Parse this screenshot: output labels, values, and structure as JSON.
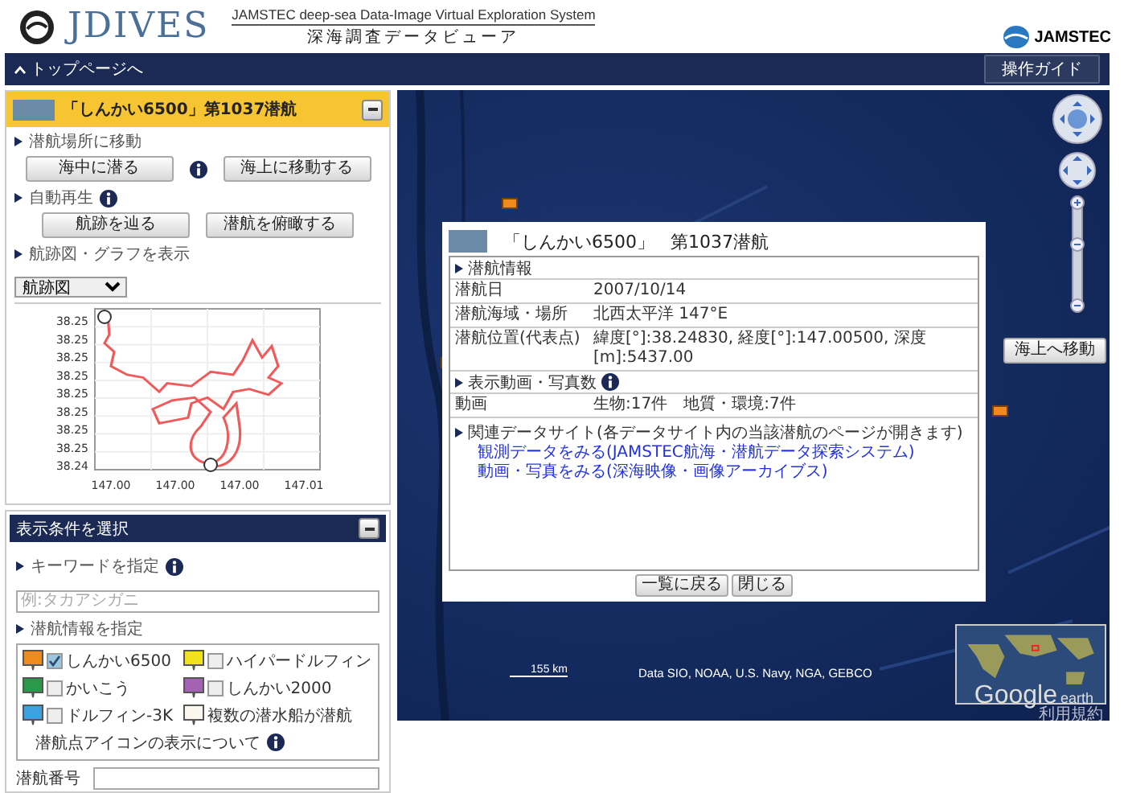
{
  "header": {
    "logo_text": "JDIVES",
    "subtitle_en": "JAMSTEC deep-sea Data-Image Virtual Exploration System",
    "subtitle_ja": "深海調査データビューア",
    "org_name": "JAMSTEC"
  },
  "nav": {
    "back_link": "トップページへ",
    "guide_button": "操作ガイド"
  },
  "dive_panel": {
    "title": "「しんかい6500」第1037潜航",
    "expanded": true,
    "sections": [
      {
        "heading": "潜航場所に移動",
        "buttons": [
          "海中に潜る",
          "海上に移動する"
        ]
      },
      {
        "heading": "自動再生",
        "buttons": [
          "航跡を辿る",
          "潜航を俯瞰する"
        ]
      }
    ],
    "graph_heading": "航跡図・グラフを表示",
    "graph_select": "航跡図",
    "track_plot": {
      "y_tick_labels": [
        "38.25",
        "38.25",
        "38.25",
        "38.25",
        "38.25",
        "38.25",
        "38.25",
        "38.25",
        "38.24"
      ],
      "x_tick_labels": [
        "147.00",
        "147.00",
        "147.00",
        "147.01"
      ]
    }
  },
  "filter_panel": {
    "title": "表示条件を選択",
    "expanded": true,
    "keyword_heading": "キーワードを指定",
    "keyword_placeholder": "例:タカアシガニ",
    "dive_heading": "潜航情報を指定",
    "vessels": [
      {
        "kind": "checkbox",
        "name": "しんかい6500",
        "color": "#f08a1c",
        "checked": true
      },
      {
        "kind": "checkbox",
        "name": "ハイパードルフィン",
        "color": "#f2e21e",
        "checked": false
      },
      {
        "kind": "checkbox",
        "name": "かいこう",
        "color": "#2a9a4a",
        "checked": false
      },
      {
        "kind": "checkbox",
        "name": "しんかい2000",
        "color": "#a462b4",
        "checked": false
      },
      {
        "kind": "checkbox",
        "name": "ドルフィン-3K",
        "color": "#3ea0e0",
        "checked": false
      },
      {
        "kind": "legend",
        "name": "複数の潜水船が潜航",
        "color": "#fbf6ee"
      }
    ],
    "icon_note": "潜航点アイコンの表示について",
    "dive_number_label": "潜航番号"
  },
  "map": {
    "move_up_button": "海上へ移動",
    "scale": "155 km",
    "attribution": "Data SIO, NOAA, U.S. Navy, NGA, GEBCO",
    "logo_google": "Google",
    "logo_earth": "earth",
    "terms_link": "利用規約",
    "popup": {
      "vessel": "「しんかい6500」",
      "dive": "第1037潜航",
      "info_heading": "潜航情報",
      "rows": [
        {
          "label": "潜航日",
          "value": "2007/10/14"
        },
        {
          "label": "潜航海域・場所",
          "value": "北西太平洋 147°E"
        },
        {
          "label": "潜航位置(代表点)",
          "value": "緯度[°]:38.24830, 経度[°]:147.00500, 深度[m]:5437.00"
        }
      ],
      "media_heading": "表示動画・写真数",
      "media_rows": [
        {
          "label": "動画",
          "value": "生物:17件　地質・環境:7件"
        }
      ],
      "links_heading": "関連データサイト(各データサイト内の当該潜航のページが開きます)",
      "links": [
        "観測データをみる(JAMSTEC航海・潜航データ探索システム)",
        "動画・写真をみる(深海映像・画像アーカイブス)"
      ],
      "buttons": [
        "一覧に戻る",
        "閉じる"
      ]
    }
  }
}
